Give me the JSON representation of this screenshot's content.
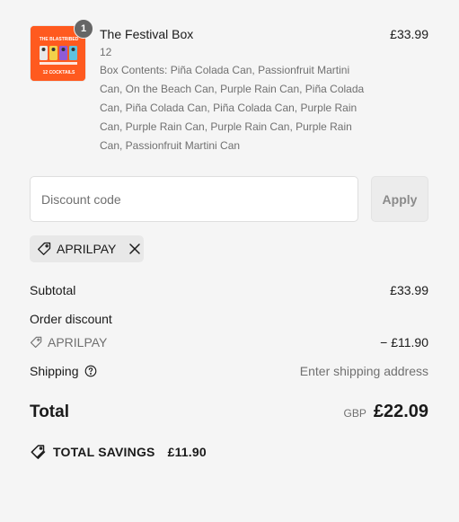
{
  "line_item": {
    "title": "The Festival Box",
    "quantity_badge": "1",
    "quantity": "12",
    "contents": "Box Contents: Piña Colada Can, Passionfruit Martini Can, On the Beach Can, Purple Rain Can, Piña Colada Can, Piña Colada Can, Piña Colada Can, Purple Rain Can, Purple Rain Can, Purple Rain Can, Purple Rain Can, Passionfruit Martini Can",
    "price": "£33.99",
    "thumbnail": {
      "brand_text": "THE BLASTRIBED",
      "caption": "12 COCKTAILS",
      "background_color": "#ff5a1f"
    }
  },
  "discount": {
    "placeholder": "Discount code",
    "value": "",
    "apply_label": "Apply",
    "applied_code": "APRILPAY"
  },
  "summary": {
    "subtotal_label": "Subtotal",
    "subtotal_value": "£33.99",
    "order_discount_label": "Order discount",
    "discount_code": "APRILPAY",
    "discount_value": "− £11.90",
    "shipping_label": "Shipping",
    "shipping_value": "Enter shipping address",
    "total_label": "Total",
    "currency": "GBP",
    "total_value": "£22.09"
  },
  "savings": {
    "label": "TOTAL SAVINGS",
    "amount": "£11.90"
  },
  "icons": {
    "tag": "tag-icon",
    "close": "close-icon",
    "help": "help-circle-icon",
    "savings": "price-tags-icon"
  }
}
